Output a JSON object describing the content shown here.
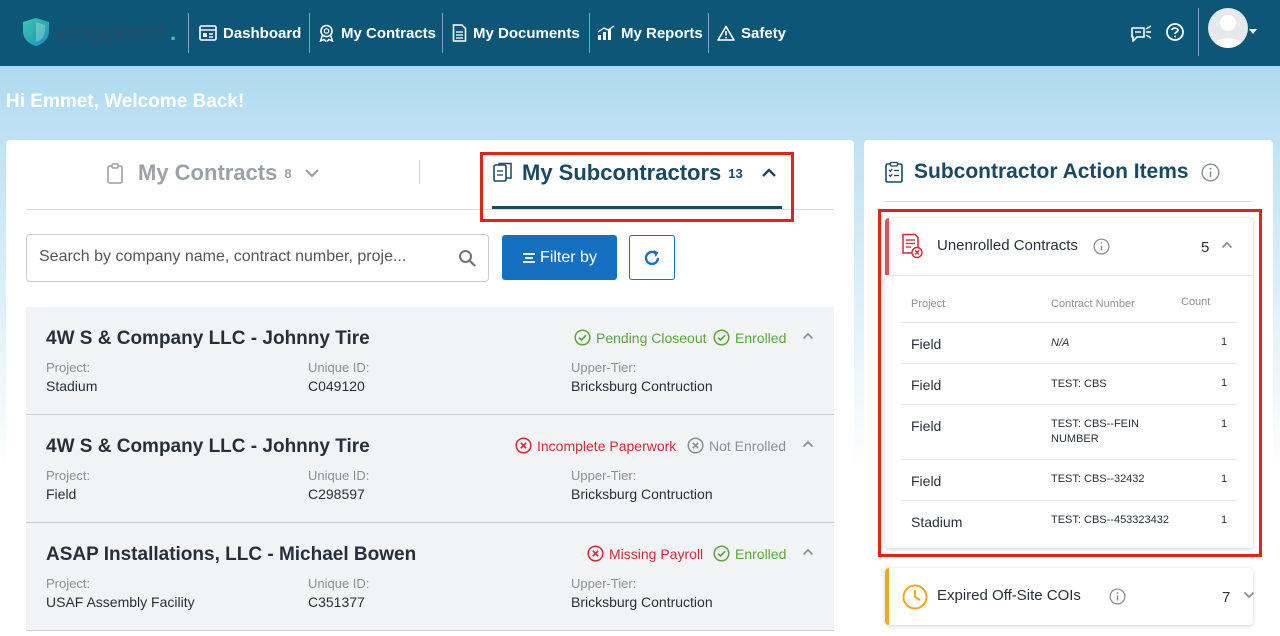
{
  "brand": {
    "name": "wrapportal",
    "dot": ".",
    "colors": {
      "nav": "#0e5677",
      "primary": "#1570c0",
      "heading": "#1b4862",
      "success": "#5aa73c",
      "danger": "#d12b3a",
      "warning": "#f5a623",
      "highlight": "#e2231a"
    }
  },
  "nav": {
    "items": [
      {
        "label": "Dashboard",
        "icon": "dashboard-icon"
      },
      {
        "label": "My Contracts",
        "icon": "award-icon"
      },
      {
        "label": "My Documents",
        "icon": "document-icon"
      },
      {
        "label": "My Reports",
        "icon": "bar-chart-icon"
      },
      {
        "label": "Safety",
        "icon": "warning-triangle-icon"
      }
    ],
    "right_icons": [
      "announcement-icon",
      "help-icon",
      "avatar"
    ]
  },
  "welcome": "Hi Emmet, Welcome Back!",
  "tabs": {
    "contracts": {
      "label": "My Contracts",
      "count": "8",
      "icon": "clipboard-icon",
      "chevron": "chevron-down-icon"
    },
    "subcontractors": {
      "label": "My Subcontractors",
      "count": "13",
      "icon": "copy-icon",
      "chevron": "chevron-up-icon",
      "active": true
    }
  },
  "search": {
    "placeholder": "Search by company name, contract number, proje...",
    "value": ""
  },
  "filter": {
    "label": "Filter by"
  },
  "field_labels": {
    "project": "Project:",
    "unique_id": "Unique ID:",
    "upper_tier": "Upper-Tier:"
  },
  "subcontractors": [
    {
      "title": "4W S & Company LLC - Johnny Tire",
      "status1": "Pending Closeout",
      "status1_kind": "green-check",
      "status2": "Enrolled",
      "status2_kind": "green-check",
      "project": "Stadium",
      "unique_id": "C049120",
      "upper_tier": "Bricksburg Contruction"
    },
    {
      "title": "4W S & Company LLC - Johnny Tire",
      "status1": "Incomplete Paperwork",
      "status1_kind": "red-x",
      "status2": "Not Enrolled",
      "status2_kind": "grey-x",
      "project": "Field",
      "unique_id": "C298597",
      "upper_tier": "Bricksburg Contruction"
    },
    {
      "title": "ASAP Installations, LLC - Michael Bowen",
      "status1": "Missing Payroll",
      "status1_kind": "red-x",
      "status2": "Enrolled",
      "status2_kind": "green-check",
      "project": "USAF Assembly Facility",
      "unique_id": "C351377",
      "upper_tier": "Bricksburg Contruction"
    }
  ],
  "action_items": {
    "title": "Subcontractor Action Items",
    "unenrolled": {
      "title": "Unenrolled Contracts",
      "count": "5",
      "columns": {
        "project": "Project",
        "number": "Contract Number",
        "count": "Count"
      },
      "rows": [
        {
          "project": "Field",
          "number": "N/A",
          "count": "1"
        },
        {
          "project": "Field",
          "number": "TEST: CBS",
          "count": "1"
        },
        {
          "project": "Field",
          "number": "TEST: CBS--FEIN NUMBER",
          "count": "1"
        },
        {
          "project": "Field",
          "number": "TEST: CBS--32432",
          "count": "1"
        },
        {
          "project": "Stadium",
          "number": "TEST: CBS--453323432",
          "count": "1"
        }
      ]
    },
    "expired": {
      "title": "Expired Off-Site COIs",
      "count": "7"
    }
  }
}
